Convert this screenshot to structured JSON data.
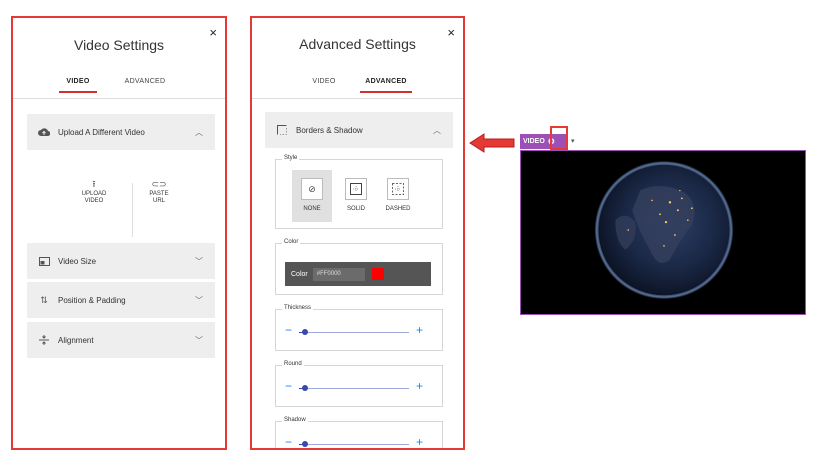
{
  "video_settings": {
    "title": "Video Settings",
    "close": "×",
    "tabs": [
      {
        "label": "VIDEO",
        "active": true
      },
      {
        "label": "ADVANCED",
        "active": false
      }
    ],
    "upload_section": {
      "label": "Upload A Different Video",
      "expanded": true
    },
    "upload_buttons": [
      {
        "label_line1": "UPLOAD",
        "label_line2": "VIDEO",
        "icon": "upload-icon"
      },
      {
        "label_line1": "PASTE",
        "label_line2": "URL",
        "icon": "link-icon"
      }
    ],
    "sections": [
      {
        "label": "Video Size",
        "icon": "video-size-icon"
      },
      {
        "label": "Position & Padding",
        "icon": "position-icon"
      },
      {
        "label": "Alignment",
        "icon": "alignment-icon"
      }
    ]
  },
  "advanced_settings": {
    "title": "Advanced Settings",
    "close": "×",
    "tabs": [
      {
        "label": "VIDEO",
        "active": false
      },
      {
        "label": "ADVANCED",
        "active": true
      }
    ],
    "borders_section": {
      "label": "Borders & Shadow",
      "expanded": true
    },
    "style": {
      "legend": "Style",
      "options": [
        {
          "label": "NONE",
          "selected": true
        },
        {
          "label": "SOLID",
          "selected": false
        },
        {
          "label": "DASHED",
          "selected": false
        }
      ]
    },
    "color": {
      "legend": "Color",
      "label": "Color",
      "value": "#FF0000",
      "swatch": "#ff0000"
    },
    "thickness": {
      "legend": "Thickness",
      "value_fraction": 0.05
    },
    "round": {
      "legend": "Round",
      "value_fraction": 0.05
    },
    "shadow": {
      "legend": "Shadow",
      "value_fraction": 0.05
    }
  },
  "video_widget": {
    "tag_label": "VIDEO",
    "gear_icon": "gear-icon",
    "caret": "▾"
  },
  "colors": {
    "highlight_red": "#e53935",
    "video_purple": "#9c4fb5",
    "slider_blue": "#3949ab"
  }
}
